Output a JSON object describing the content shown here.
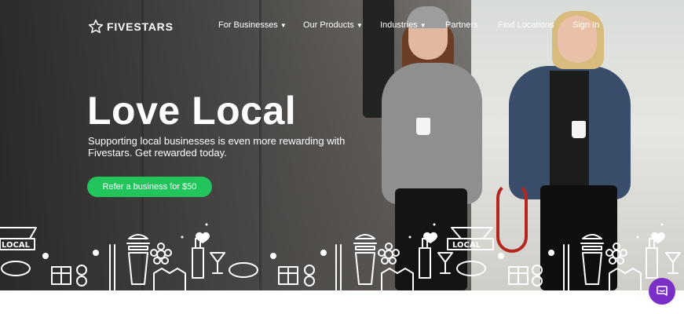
{
  "brand": {
    "name": "FIVESTARS"
  },
  "nav": {
    "items": [
      {
        "label": "For Businesses",
        "has_dropdown": true
      },
      {
        "label": "Our Products",
        "has_dropdown": true
      },
      {
        "label": "Industries",
        "has_dropdown": true
      },
      {
        "label": "Partners",
        "has_dropdown": false
      },
      {
        "label": "Find Locations",
        "has_dropdown": false
      },
      {
        "label": "Sign In",
        "has_dropdown": false
      }
    ],
    "caret": "▼"
  },
  "hero": {
    "headline": "Love Local",
    "subtext": "Supporting local businesses is even more rewarding with Fivestars. Get rewarded today.",
    "cta_label": "Refer a business for $50",
    "doodle_sign_text": "LOCAL"
  },
  "colors": {
    "cta": "#22c45c",
    "chat": "#7b2fc9",
    "text_on_hero": "#ffffff"
  },
  "icons": {
    "logo": "star-outline-icon",
    "chat": "chat-bubble-icon"
  }
}
